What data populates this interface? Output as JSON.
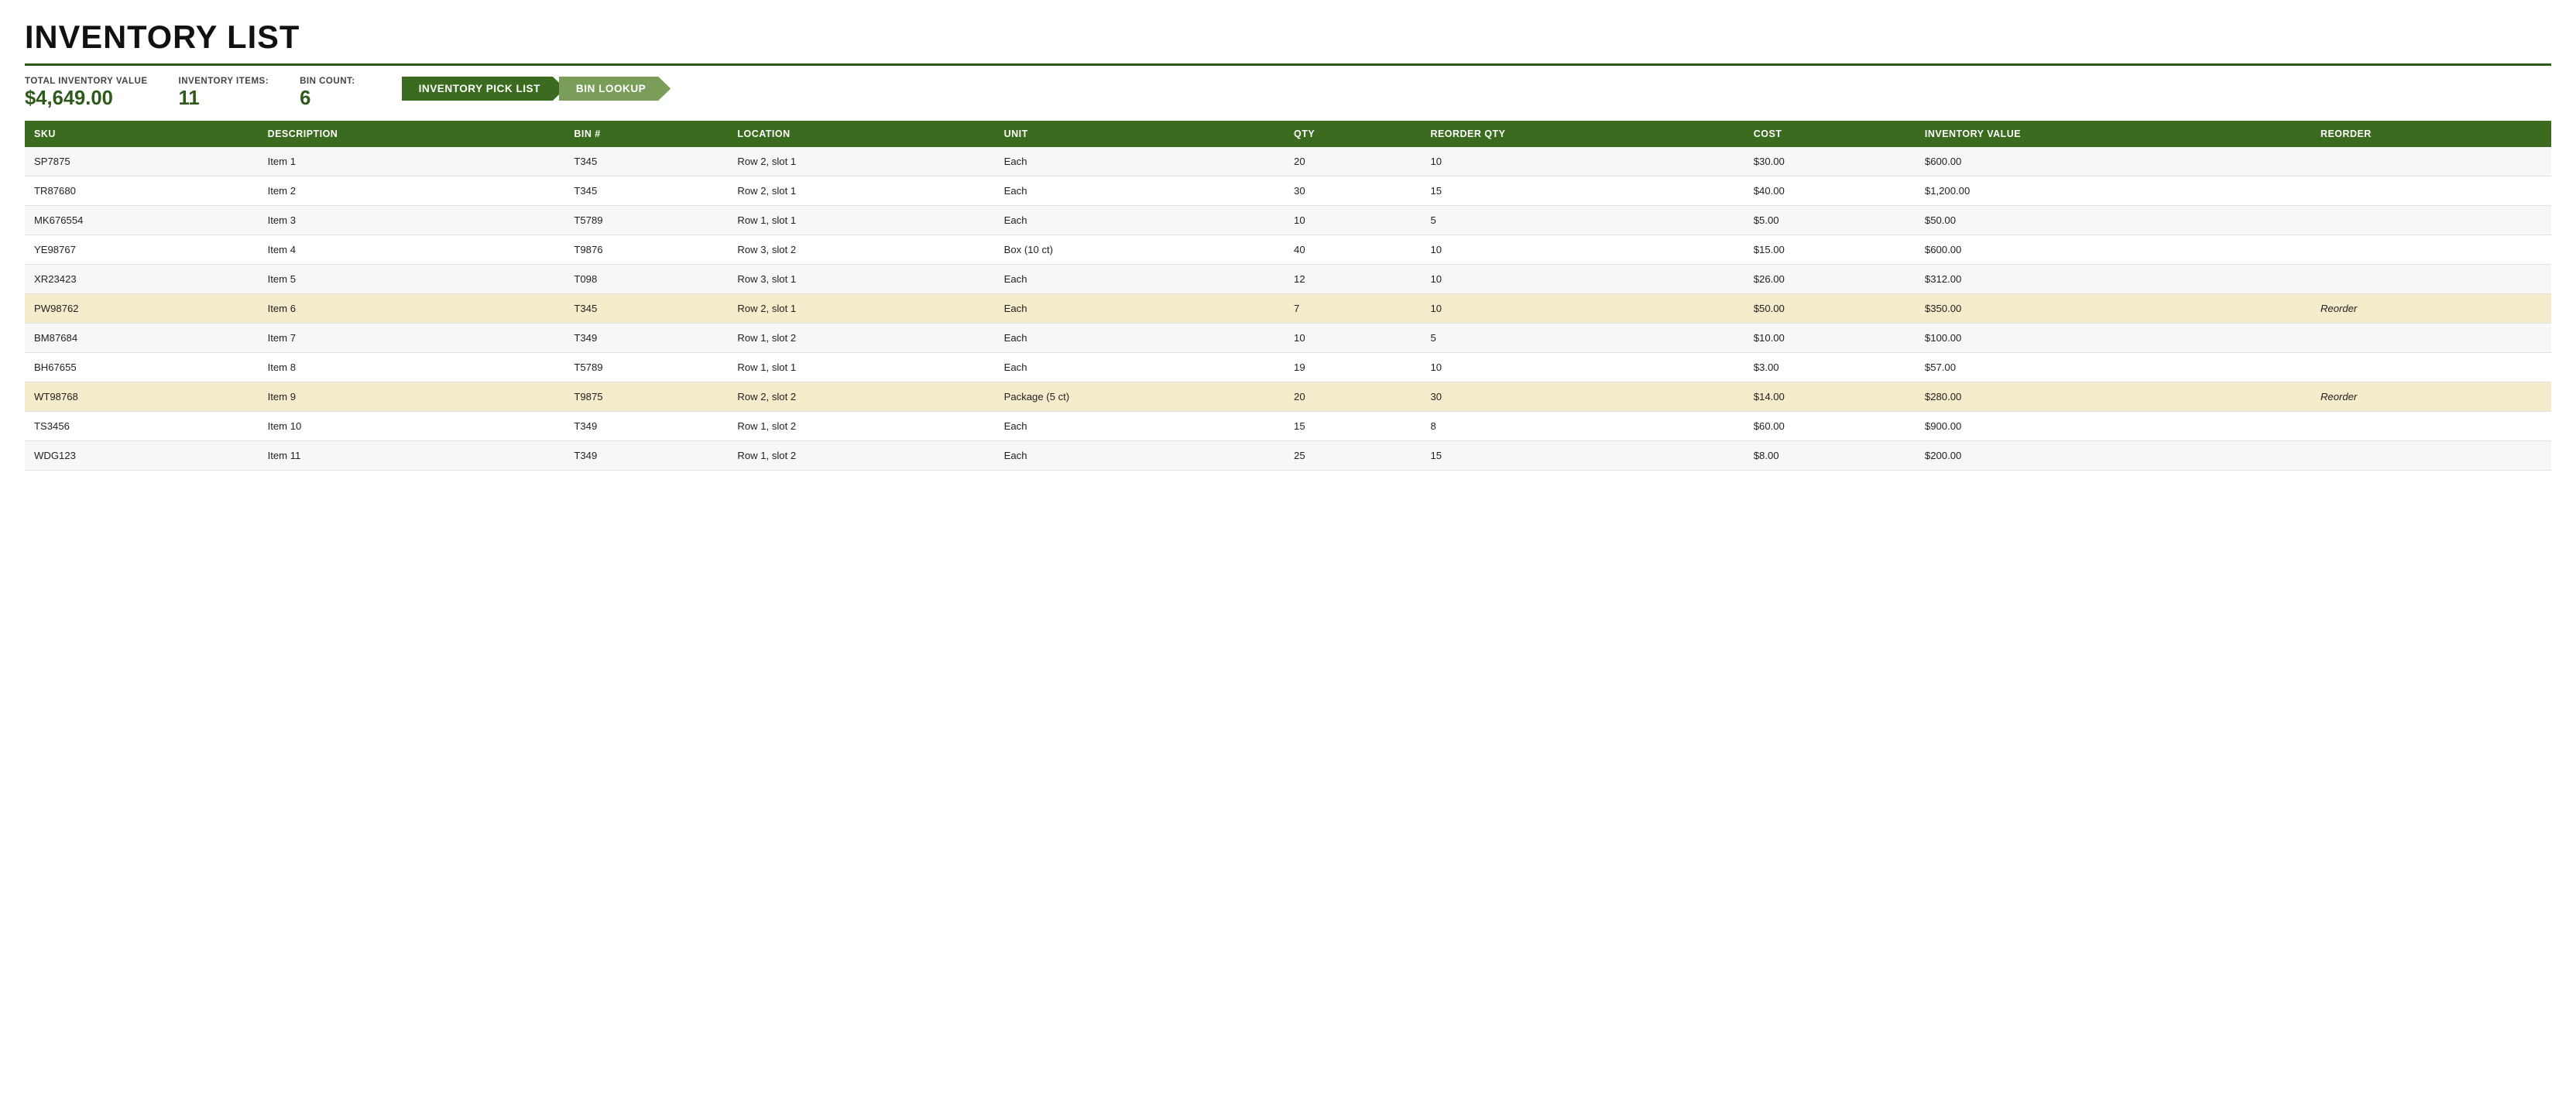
{
  "page": {
    "title": "INVENTORY LIST",
    "summary": {
      "total_inventory_label": "TOTAL INVENTORY VALUE",
      "total_inventory_value": "$4,649.00",
      "items_label": "INVENTORY ITEMS:",
      "items_value": "11",
      "bin_count_label": "BIN COUNT:",
      "bin_count_value": "6"
    },
    "tabs": [
      {
        "id": "pick-list",
        "label": "INVENTORY PICK LIST",
        "active": true
      },
      {
        "id": "bin-lookup",
        "label": "BIN LOOKUP",
        "active": false
      }
    ],
    "table": {
      "columns": [
        "SKU",
        "DESCRIPTION",
        "BIN #",
        "LOCATION",
        "UNIT",
        "QTY",
        "REORDER QTY",
        "COST",
        "INVENTORY VALUE",
        "REORDER"
      ],
      "rows": [
        {
          "sku": "SP7875",
          "description": "Item 1",
          "bin": "T345",
          "location": "Row 2, slot 1",
          "unit": "Each",
          "qty": "20",
          "reorder_qty": "10",
          "cost": "$30.00",
          "inv_value": "$600.00",
          "reorder": "",
          "highlight": false
        },
        {
          "sku": "TR87680",
          "description": "Item 2",
          "bin": "T345",
          "location": "Row 2, slot 1",
          "unit": "Each",
          "qty": "30",
          "reorder_qty": "15",
          "cost": "$40.00",
          "inv_value": "$1,200.00",
          "reorder": "",
          "highlight": false
        },
        {
          "sku": "MK676554",
          "description": "Item 3",
          "bin": "T5789",
          "location": "Row 1, slot 1",
          "unit": "Each",
          "qty": "10",
          "reorder_qty": "5",
          "cost": "$5.00",
          "inv_value": "$50.00",
          "reorder": "",
          "highlight": false
        },
        {
          "sku": "YE98767",
          "description": "Item 4",
          "bin": "T9876",
          "location": "Row 3, slot 2",
          "unit": "Box (10 ct)",
          "qty": "40",
          "reorder_qty": "10",
          "cost": "$15.00",
          "inv_value": "$600.00",
          "reorder": "",
          "highlight": false
        },
        {
          "sku": "XR23423",
          "description": "Item 5",
          "bin": "T098",
          "location": "Row 3, slot 1",
          "unit": "Each",
          "qty": "12",
          "reorder_qty": "10",
          "cost": "$26.00",
          "inv_value": "$312.00",
          "reorder": "",
          "highlight": false
        },
        {
          "sku": "PW98762",
          "description": "Item 6",
          "bin": "T345",
          "location": "Row 2, slot 1",
          "unit": "Each",
          "qty": "7",
          "reorder_qty": "10",
          "cost": "$50.00",
          "inv_value": "$350.00",
          "reorder": "Reorder",
          "highlight": true
        },
        {
          "sku": "BM87684",
          "description": "Item 7",
          "bin": "T349",
          "location": "Row 1, slot 2",
          "unit": "Each",
          "qty": "10",
          "reorder_qty": "5",
          "cost": "$10.00",
          "inv_value": "$100.00",
          "reorder": "",
          "highlight": false
        },
        {
          "sku": "BH67655",
          "description": "Item 8",
          "bin": "T5789",
          "location": "Row 1, slot 1",
          "unit": "Each",
          "qty": "19",
          "reorder_qty": "10",
          "cost": "$3.00",
          "inv_value": "$57.00",
          "reorder": "",
          "highlight": false
        },
        {
          "sku": "WT98768",
          "description": "Item 9",
          "bin": "T9875",
          "location": "Row 2, slot 2",
          "unit": "Package (5 ct)",
          "qty": "20",
          "reorder_qty": "30",
          "cost": "$14.00",
          "inv_value": "$280.00",
          "reorder": "Reorder",
          "highlight": true
        },
        {
          "sku": "TS3456",
          "description": "Item 10",
          "bin": "T349",
          "location": "Row 1, slot 2",
          "unit": "Each",
          "qty": "15",
          "reorder_qty": "8",
          "cost": "$60.00",
          "inv_value": "$900.00",
          "reorder": "",
          "highlight": false
        },
        {
          "sku": "WDG123",
          "description": "Item 11",
          "bin": "T349",
          "location": "Row 1, slot 2",
          "unit": "Each",
          "qty": "25",
          "reorder_qty": "15",
          "cost": "$8.00",
          "inv_value": "$200.00",
          "reorder": "",
          "highlight": false
        }
      ]
    }
  }
}
